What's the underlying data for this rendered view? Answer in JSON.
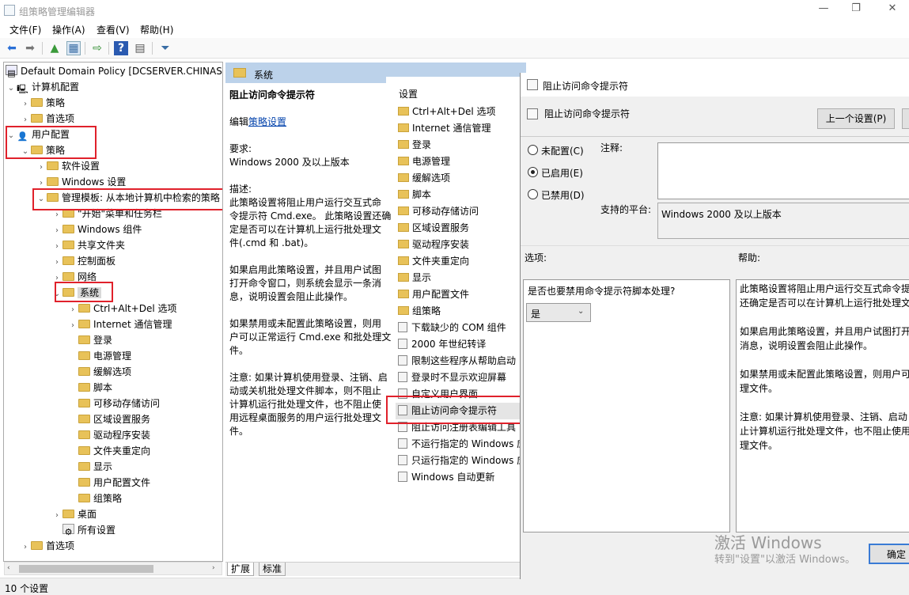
{
  "window": {
    "title": "组策略管理编辑器",
    "controls": [
      "—",
      "❐",
      "✕"
    ]
  },
  "menu": [
    "文件(F)",
    "操作(A)",
    "查看(V)",
    "帮助(H)"
  ],
  "tree": {
    "items": [
      {
        "label": "Default Domain Policy [DCSERVER.CHINASK"
      },
      {
        "label": "计算机配置"
      },
      {
        "label": "策略"
      },
      {
        "label": "首选项"
      },
      {
        "label": "用户配置"
      },
      {
        "label": "策略"
      },
      {
        "label": "软件设置"
      },
      {
        "label": "Windows 设置"
      },
      {
        "label": "管理模板: 从本地计算机中检索的策略"
      },
      {
        "label": "\"开始\"菜单和任务栏"
      },
      {
        "label": "Windows 组件"
      },
      {
        "label": "共享文件夹"
      },
      {
        "label": "控制面板"
      },
      {
        "label": "网络"
      },
      {
        "label": "系统"
      },
      {
        "label": "Ctrl+Alt+Del 选项"
      },
      {
        "label": "Internet 通信管理"
      },
      {
        "label": "登录"
      },
      {
        "label": "电源管理"
      },
      {
        "label": "缓解选项"
      },
      {
        "label": "脚本"
      },
      {
        "label": "可移动存储访问"
      },
      {
        "label": "区域设置服务"
      },
      {
        "label": "驱动程序安装"
      },
      {
        "label": "文件夹重定向"
      },
      {
        "label": "显示"
      },
      {
        "label": "用户配置文件"
      },
      {
        "label": "组策略"
      },
      {
        "label": "桌面"
      },
      {
        "label": "所有设置"
      },
      {
        "label": "首选项"
      }
    ]
  },
  "middle": {
    "header": "系统",
    "policy_title": "阻止访问命令提示符",
    "edit_prefix": "编辑",
    "edit_link": "策略设置",
    "req_label": "要求:",
    "req_value": "Windows 2000 及以上版本",
    "desc_label": "描述:",
    "desc_lines": [
      "此策略设置将阻止用户运行交互式命",
      "令提示符 Cmd.exe。 此策略设置还确",
      "定是否可以在计算机上运行批处理文",
      "件(.cmd 和 .bat)。",
      "",
      "如果启用此策略设置，并且用户试图",
      "打开命令窗口，则系统会显示一条消",
      "息，说明设置会阻止此操作。",
      "",
      "如果禁用或未配置此策略设置，则用",
      "户可以正常运行 Cmd.exe 和批处理文",
      "件。",
      "",
      "注意: 如果计算机使用登录、注销、启",
      "动或关机批处理文件脚本，则不阻止",
      "计算机运行批处理文件，也不阻止使",
      "用远程桌面服务的用户运行批处理文",
      "件。"
    ],
    "settings_header": "设置",
    "settings": [
      {
        "label": "Ctrl+Alt+Del 选项",
        "kind": "folder"
      },
      {
        "label": "Internet 通信管理",
        "kind": "folder"
      },
      {
        "label": "登录",
        "kind": "folder"
      },
      {
        "label": "电源管理",
        "kind": "folder"
      },
      {
        "label": "缓解选项",
        "kind": "folder"
      },
      {
        "label": "脚本",
        "kind": "folder"
      },
      {
        "label": "可移动存储访问",
        "kind": "folder"
      },
      {
        "label": "区域设置服务",
        "kind": "folder"
      },
      {
        "label": "驱动程序安装",
        "kind": "folder"
      },
      {
        "label": "文件夹重定向",
        "kind": "folder"
      },
      {
        "label": "显示",
        "kind": "folder"
      },
      {
        "label": "用户配置文件",
        "kind": "folder"
      },
      {
        "label": "组策略",
        "kind": "folder"
      },
      {
        "label": "下载缺少的 COM 组件",
        "kind": "policy"
      },
      {
        "label": "2000 年世纪转译",
        "kind": "policy"
      },
      {
        "label": "限制这些程序从帮助启动",
        "kind": "policy"
      },
      {
        "label": "登录时不显示欢迎屏幕",
        "kind": "policy"
      },
      {
        "label": "自定义用户界面",
        "kind": "policy"
      },
      {
        "label": "阻止访问命令提示符",
        "kind": "policy"
      },
      {
        "label": "阻止访问注册表编辑工具",
        "kind": "policy"
      },
      {
        "label": "不运行指定的 Windows 应用程序",
        "kind": "policy"
      },
      {
        "label": "只运行指定的 Windows 应用程序",
        "kind": "policy"
      },
      {
        "label": "Windows 自动更新",
        "kind": "policy"
      }
    ],
    "tabs": [
      "扩展",
      "标准"
    ]
  },
  "status": "10 个设置",
  "dialog": {
    "title": "阻止访问命令提示符",
    "subtitle": "阻止访问命令提示符",
    "prev_button": "上一个设置(P)",
    "radios": [
      "未配置(C)",
      "已启用(E)",
      "已禁用(D)"
    ],
    "selected_radio": "已启用(E)",
    "comment_label": "注释:",
    "platform_label": "支持的平台:",
    "platform_value": "Windows 2000 及以上版本",
    "options_label": "选项:",
    "help_label": "帮助:",
    "option_question": "是否也要禁用命令提示符脚本处理?",
    "option_value": "是",
    "help_lines": [
      "此策略设置将阻止用户运行交互式命令提",
      "还确定是否可以在计算机上运行批处理文",
      "",
      "如果启用此策略设置，并且用户试图打开",
      "消息，说明设置会阻止此操作。",
      "",
      "如果禁用或未配置此策略设置，则用户可",
      "理文件。",
      "",
      "注意: 如果计算机使用登录、注销、启动",
      "止计算机运行批处理文件，也不阻止使用",
      "理文件。"
    ],
    "ok_button": "确定"
  },
  "watermark": {
    "line1": "激活 Windows",
    "line2": "转到\"设置\"以激活 Windows。"
  }
}
